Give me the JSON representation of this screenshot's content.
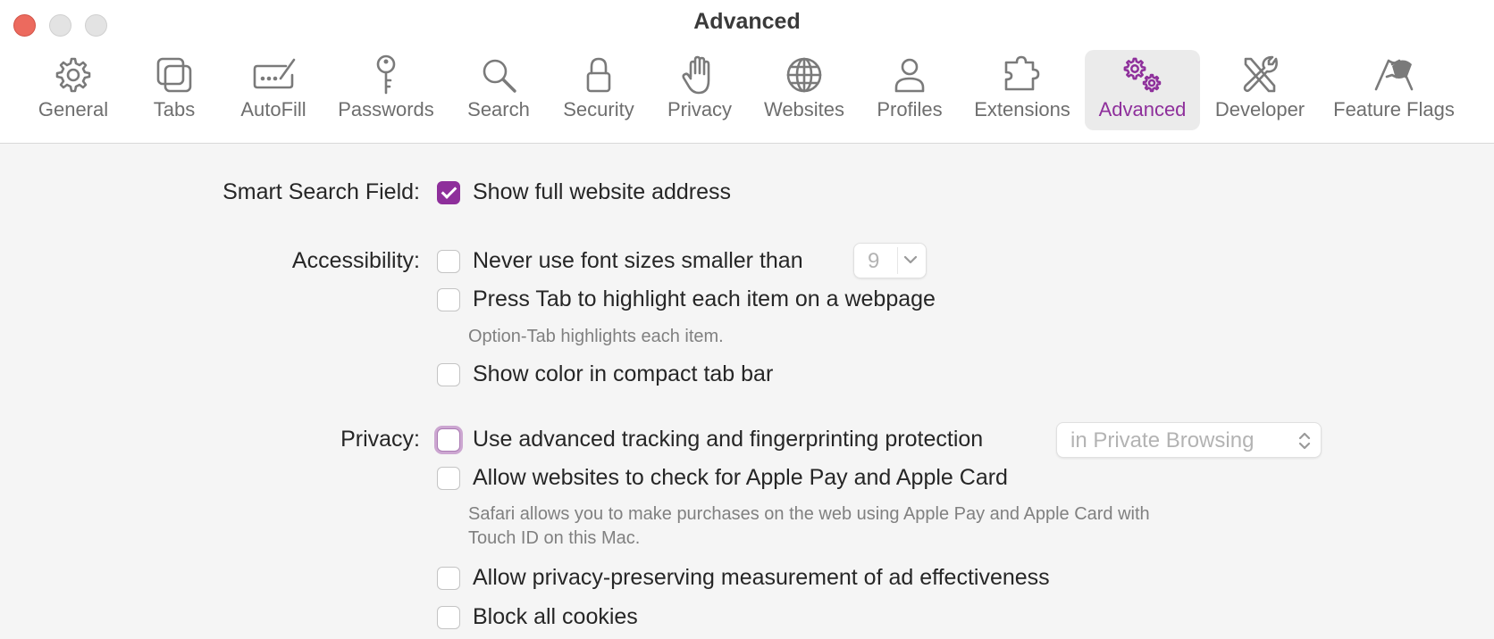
{
  "window": {
    "title": "Advanced"
  },
  "tabs": [
    {
      "label": "General",
      "icon": "gear-icon"
    },
    {
      "label": "Tabs",
      "icon": "tabs-icon"
    },
    {
      "label": "AutoFill",
      "icon": "autofill-icon"
    },
    {
      "label": "Passwords",
      "icon": "key-icon"
    },
    {
      "label": "Search",
      "icon": "search-icon"
    },
    {
      "label": "Security",
      "icon": "lock-icon"
    },
    {
      "label": "Privacy",
      "icon": "hand-icon"
    },
    {
      "label": "Websites",
      "icon": "globe-icon"
    },
    {
      "label": "Profiles",
      "icon": "person-icon"
    },
    {
      "label": "Extensions",
      "icon": "puzzle-icon"
    },
    {
      "label": "Advanced",
      "icon": "gears-icon",
      "selected": true
    },
    {
      "label": "Developer",
      "icon": "tools-icon"
    },
    {
      "label": "Feature Flags",
      "icon": "flags-icon"
    }
  ],
  "settings": {
    "smart_search": {
      "label": "Smart Search Field:",
      "show_full_address": {
        "label": "Show full website address",
        "checked": true
      }
    },
    "accessibility": {
      "label": "Accessibility:",
      "min_font": {
        "label": "Never use font sizes smaller than",
        "checked": false,
        "value": "9"
      },
      "press_tab": {
        "label": "Press Tab to highlight each item on a webpage",
        "checked": false,
        "note": "Option-Tab highlights each item."
      },
      "color_compact": {
        "label": "Show color in compact tab bar",
        "checked": false
      }
    },
    "privacy": {
      "label": "Privacy:",
      "tracking": {
        "label": "Use advanced tracking and fingerprinting protection",
        "checked": false,
        "focused": true,
        "scope": "in Private Browsing"
      },
      "apple_pay": {
        "label": "Allow websites to check for Apple Pay and Apple Card",
        "checked": false,
        "note_line1": "Safari allows you to make purchases on the web using Apple Pay and Apple Card with",
        "note_line2": "Touch ID on this Mac."
      },
      "ad_measurement": {
        "label": "Allow privacy-preserving measurement of ad effectiveness",
        "checked": false
      },
      "block_cookies": {
        "label": "Block all cookies",
        "checked": false
      }
    }
  },
  "colors": {
    "accent": "#8e2f9b",
    "close_button": "#ec6a5e"
  }
}
